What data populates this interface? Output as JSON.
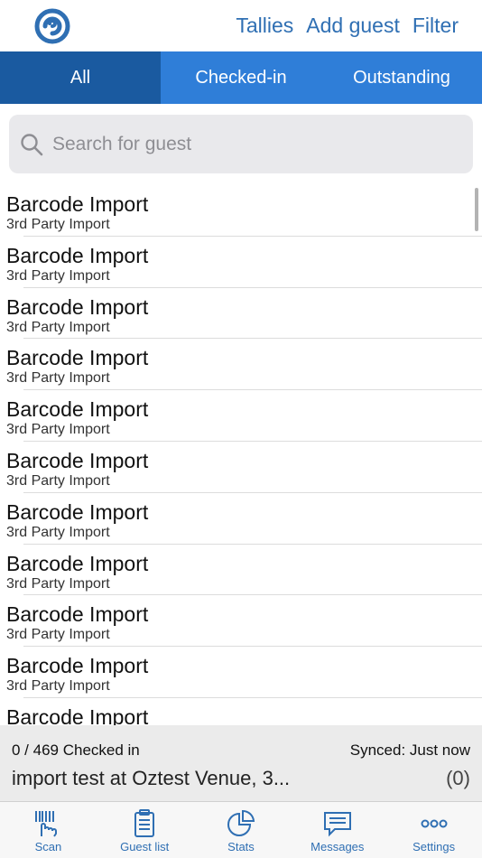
{
  "header": {
    "links": [
      "Tallies",
      "Add guest",
      "Filter"
    ]
  },
  "segments": [
    "All",
    "Checked-in",
    "Outstanding"
  ],
  "search": {
    "placeholder": "Search for guest"
  },
  "guests": [
    {
      "name": "Barcode Import",
      "source": "3rd Party Import"
    },
    {
      "name": "Barcode Import",
      "source": "3rd Party Import"
    },
    {
      "name": "Barcode Import",
      "source": "3rd Party Import"
    },
    {
      "name": "Barcode Import",
      "source": "3rd Party Import"
    },
    {
      "name": "Barcode Import",
      "source": "3rd Party Import"
    },
    {
      "name": "Barcode Import",
      "source": "3rd Party Import"
    },
    {
      "name": "Barcode Import",
      "source": "3rd Party Import"
    },
    {
      "name": "Barcode Import",
      "source": "3rd Party Import"
    },
    {
      "name": "Barcode Import",
      "source": "3rd Party Import"
    },
    {
      "name": "Barcode Import",
      "source": "3rd Party Import"
    },
    {
      "name": "Barcode Import",
      "source": ""
    }
  ],
  "status": {
    "checked_in": "0 / 469 Checked in",
    "synced": "Synced: Just now",
    "event": "import test at Oztest Venue, 3...",
    "pending": "(0)"
  },
  "tabs": [
    "Scan",
    "Guest list",
    "Stats",
    "Messages",
    "Settings"
  ],
  "colors": {
    "accent": "#2f6fb3",
    "segment_bg": "#2f7ed8",
    "segment_active": "#1a5aa0"
  }
}
